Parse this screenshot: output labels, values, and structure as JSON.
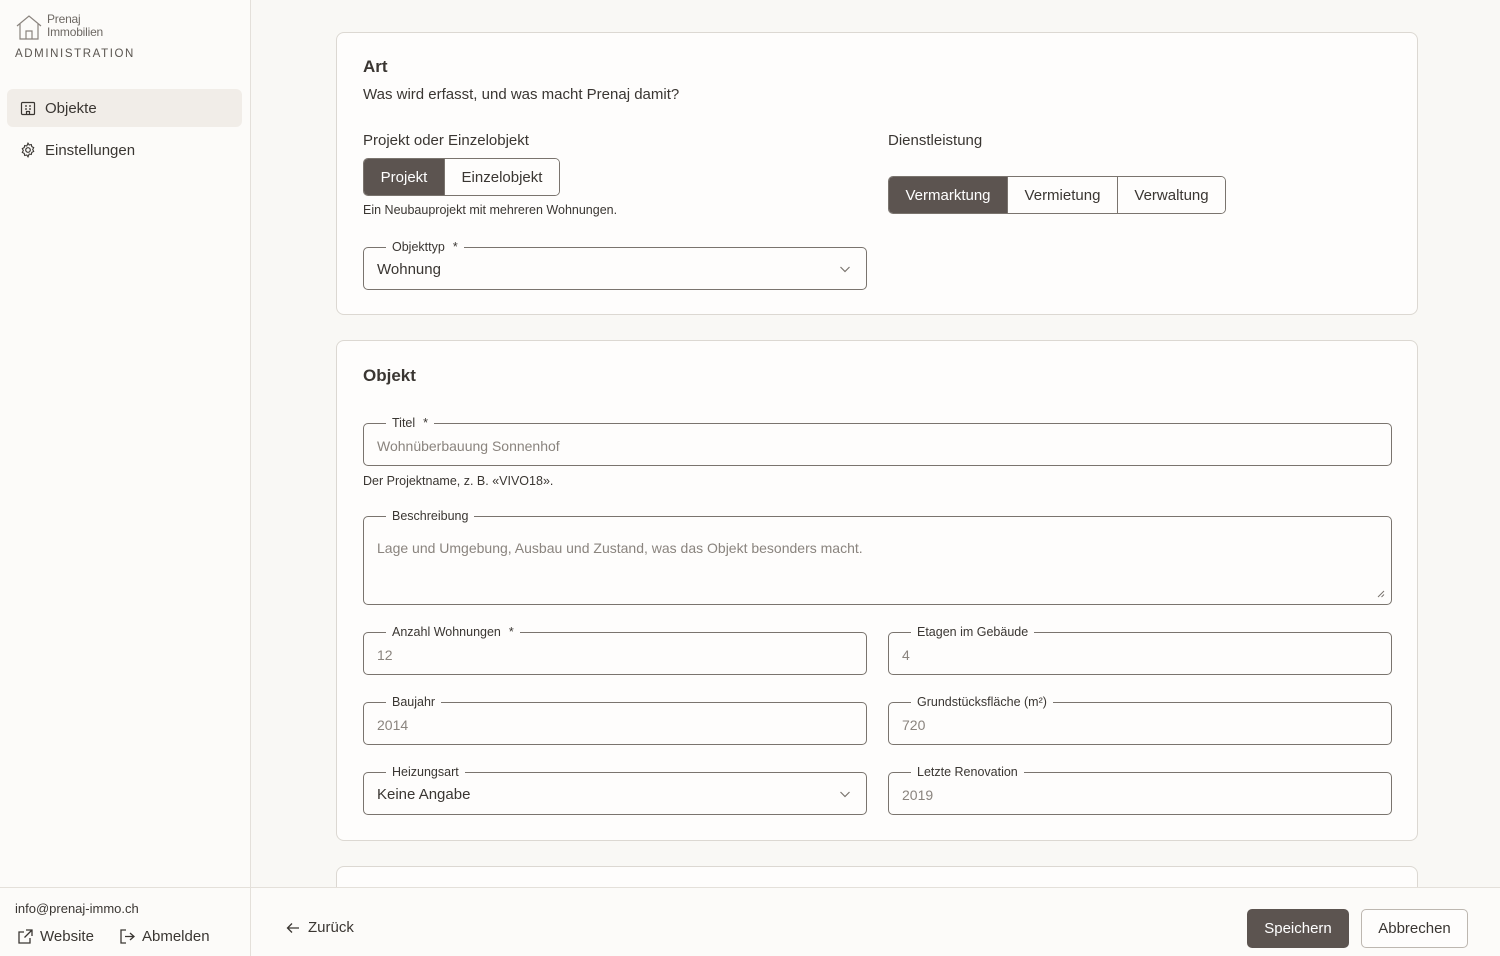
{
  "brand": {
    "logo_line1": "Prenaj",
    "logo_line2": "Immobilien",
    "section": "ADMINISTRATION"
  },
  "sidebar": {
    "items": [
      {
        "label": "Objekte",
        "icon": "building-icon",
        "active": true
      },
      {
        "label": "Einstellungen",
        "icon": "gear-icon",
        "active": false
      }
    ],
    "email": "info@prenaj-immo.ch",
    "website_label": "Website",
    "logout_label": "Abmelden"
  },
  "art": {
    "title": "Art",
    "subtitle": "Was wird erfasst, und was macht Prenaj damit?",
    "kind_label": "Projekt oder Einzelobjekt",
    "kind_options": [
      "Projekt",
      "Einzelobjekt"
    ],
    "kind_selected": "Projekt",
    "kind_helper": "Ein Neubauprojekt mit mehreren Wohnungen.",
    "service_label": "Dienstleistung",
    "service_options": [
      "Vermarktung",
      "Vermietung",
      "Verwaltung"
    ],
    "service_selected": "Vermarktung",
    "objekttyp_label": "Objekttyp",
    "objekttyp_value": "Wohnung"
  },
  "objekt": {
    "title": "Objekt",
    "titel_label": "Titel",
    "titel_placeholder": "Wohnüberbauung Sonnenhof",
    "titel_helper": "Der Projektname, z. B. «VIVO18».",
    "beschreibung_label": "Beschreibung",
    "beschreibung_placeholder": "Lage und Umgebung, Ausbau und Zustand, was das Objekt besonders macht.",
    "anzahl_label": "Anzahl Wohnungen",
    "anzahl_placeholder": "12",
    "etagen_label": "Etagen im Gebäude",
    "etagen_placeholder": "4",
    "baujahr_label": "Baujahr",
    "baujahr_placeholder": "2014",
    "grund_label": "Grundstücksfläche (m²)",
    "grund_placeholder": "720",
    "heizung_label": "Heizungsart",
    "heizung_value": "Keine Angabe",
    "renovation_label": "Letzte Renovation",
    "renovation_placeholder": "2019"
  },
  "required_mark": "*",
  "actions": {
    "back": "Zurück",
    "save": "Speichern",
    "cancel": "Abbrechen"
  },
  "colors": {
    "accent": "#5c5450",
    "border": "#7a746e",
    "background": "#f9f8f5"
  }
}
